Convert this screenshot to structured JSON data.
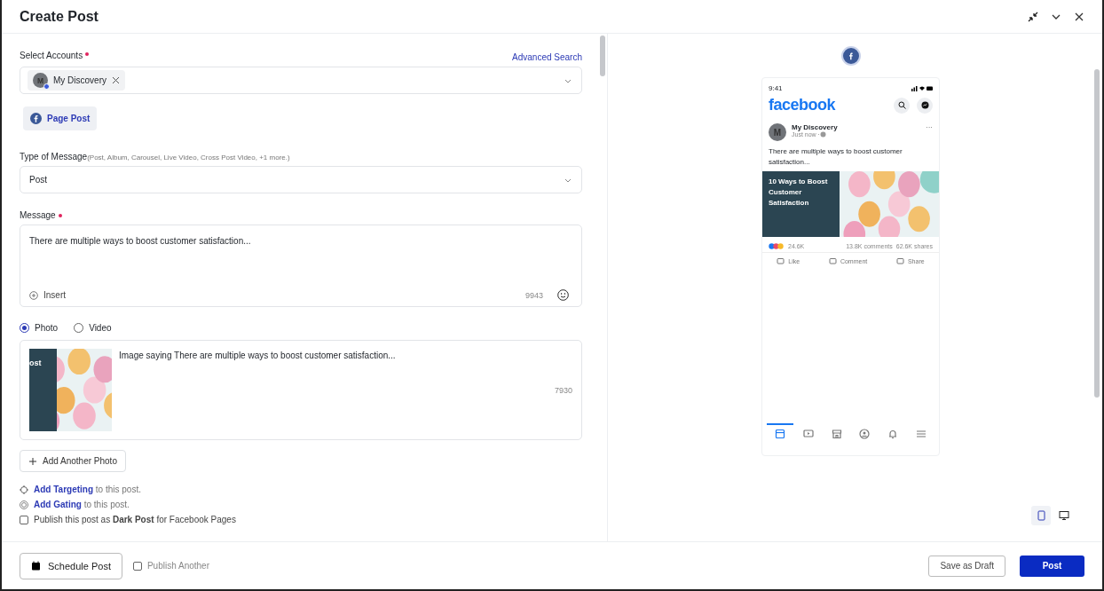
{
  "window": {
    "title": "Create Post"
  },
  "accounts": {
    "label": "Select Accounts",
    "required": true,
    "link": "Advanced Search",
    "chips": [
      {
        "initial": "M",
        "name": "My Discovery"
      }
    ]
  },
  "post_types": [
    {
      "label": "Page Post",
      "selected": true
    }
  ],
  "message_type": {
    "label": "Type of Message",
    "hint": "(Post, Album, Carousel, Live Video, Cross Post Video, +1 more.)",
    "value": "Post"
  },
  "message": {
    "label": "Message",
    "required": true,
    "value": "There are multiple ways to boost customer satisfaction...",
    "insert": "Insert",
    "count": "9943"
  },
  "media_options": [
    {
      "label": "Photo",
      "selected": true
    },
    {
      "label": "Video",
      "selected": false
    }
  ],
  "photo": {
    "thumb_text": "ost",
    "caption": "Image saying There are multiple ways to boost customer satisfaction...",
    "count": "7930"
  },
  "add_photo": "Add Another Photo",
  "extras": [
    {
      "kind": "targeting",
      "link": "Add Targeting",
      "rest": "to this post."
    },
    {
      "kind": "gating",
      "link": "Add Gating",
      "rest": "to this post."
    },
    {
      "kind": "checkbox",
      "checked": false,
      "text": "Publish this post as **Dark Post** for Facebook Pages"
    }
  ],
  "preview": {
    "time": "9:41",
    "brand": "facebook",
    "author_initial": "M",
    "author": "My Discovery",
    "when": "Just now · ",
    "more": "···",
    "text": "There are multiple ways to boost customer satisfaction...",
    "image_title": "10 Ways to Boost Customer Satisfaction",
    "reactions": "24.6K",
    "comments": "13.8K comments",
    "shares": "62.6K shares",
    "actions": [
      "Like",
      "Comment",
      "Share"
    ],
    "nav": [
      {
        "kind": "feed",
        "selected": true
      },
      {
        "kind": "video",
        "selected": false
      },
      {
        "kind": "market",
        "selected": false
      },
      {
        "kind": "groups",
        "selected": false
      },
      {
        "kind": "bell",
        "selected": false
      },
      {
        "kind": "menu",
        "selected": false
      }
    ]
  },
  "devices": [
    {
      "kind": "mobile",
      "selected": true
    },
    {
      "kind": "desktop",
      "selected": false
    }
  ],
  "footer": {
    "schedule": "Schedule Post",
    "publish_another": {
      "label": "Publish Another",
      "checked": false
    },
    "draft": "Save as Draft",
    "post": "Post"
  }
}
